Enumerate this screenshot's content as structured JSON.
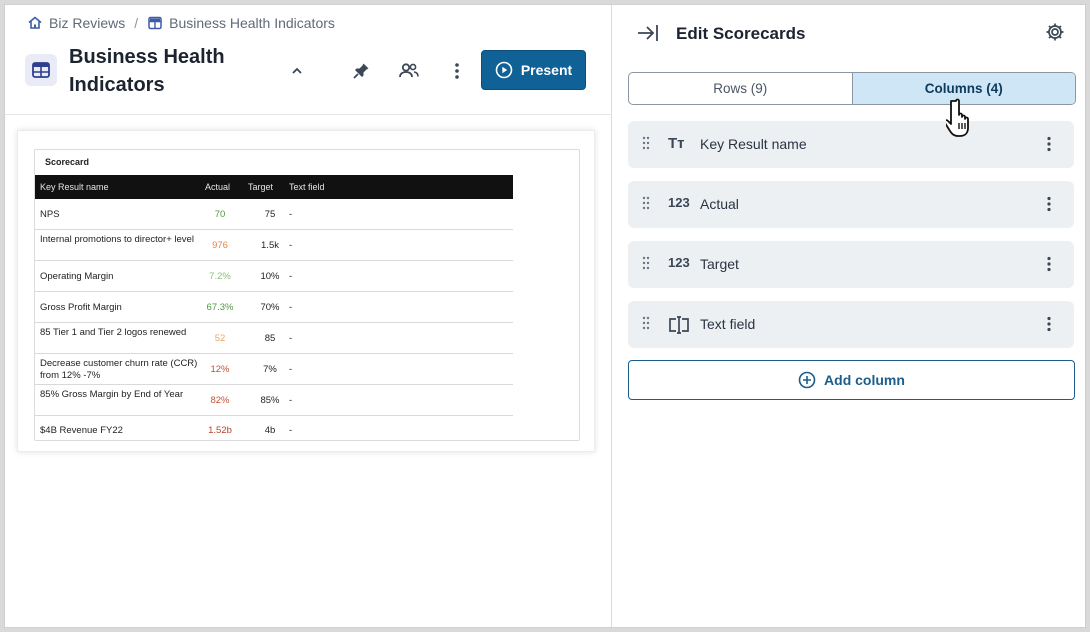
{
  "breadcrumb": {
    "parent": "Biz Reviews",
    "separator": "/",
    "current": "Business Health Indicators"
  },
  "header": {
    "title": "Business Health Indicators",
    "present_label": "Present"
  },
  "scorecard": {
    "title": "Scorecard",
    "columns": [
      "Key Result name",
      "Actual",
      "Target",
      "Text field"
    ],
    "rows": [
      {
        "name": "NPS",
        "actual": "70",
        "target": "75",
        "text": "-",
        "actual_color": "#4f9a3c"
      },
      {
        "name": "Internal promotions to director+ level",
        "actual": "976",
        "target": "1.5k",
        "text": "-",
        "actual_color": "#e0884a"
      },
      {
        "name": "Operating Margin",
        "actual": "7.2%",
        "target": "10%",
        "text": "-",
        "actual_color": "#8bc07a"
      },
      {
        "name": "Gross Profit Margin",
        "actual": "67.3%",
        "target": "70%",
        "text": "-",
        "actual_color": "#4f9a3c"
      },
      {
        "name": "85 Tier 1 and Tier 2 logos renewed",
        "actual": "52",
        "target": "85",
        "text": "-",
        "actual_color": "#e8a56a"
      },
      {
        "name": "Decrease customer churn rate (CCR) from 12% -7%",
        "actual": "12%",
        "target": "7%",
        "text": "-",
        "actual_color": "#c8502f"
      },
      {
        "name": "85% Gross Margin by End of Year",
        "actual": "82%",
        "target": "85%",
        "text": "-",
        "actual_color": "#c8502f"
      },
      {
        "name": "$4B Revenue FY22",
        "actual": "1.52b",
        "target": "4b",
        "text": "-",
        "actual_color": "#b7422a"
      }
    ]
  },
  "panel": {
    "title": "Edit Scorecards",
    "tabs": [
      {
        "label": "Rows (9)",
        "active": false
      },
      {
        "label": "Columns (4)",
        "active": true
      }
    ],
    "columns": [
      {
        "type_icon": "Tт",
        "label": "Key Result name"
      },
      {
        "type_icon": "123",
        "label": "Actual"
      },
      {
        "type_icon": "123",
        "label": "Target"
      },
      {
        "type_icon": "text-field-icon",
        "label": "Text field"
      }
    ],
    "add_column_label": "Add column"
  },
  "colors": {
    "primary": "#0f6196",
    "active_tab": "#cfe6f6",
    "column_bg": "#edf0f3"
  }
}
